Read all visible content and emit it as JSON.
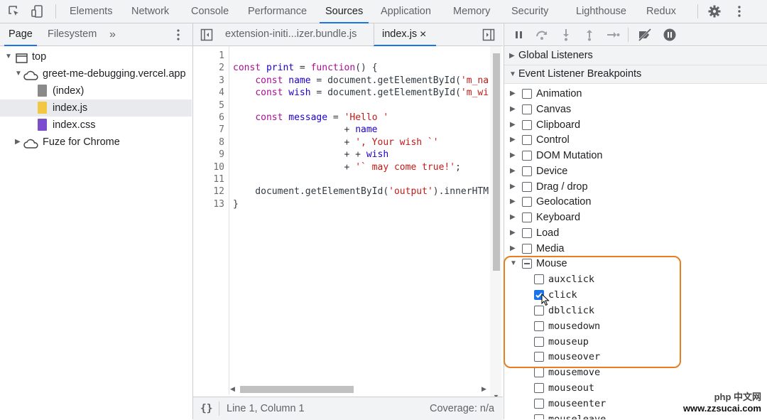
{
  "toolbar": {
    "tabs": [
      "Elements",
      "Network",
      "Console",
      "Performance",
      "Sources",
      "Application",
      "Memory",
      "Security",
      "Lighthouse",
      "Redux"
    ],
    "active_tab": "Sources"
  },
  "navigator": {
    "tabs": [
      "Page",
      "Filesystem"
    ],
    "more": "»",
    "tree": {
      "top": "top",
      "domain": "greet-me-debugging.vercel.app",
      "files": [
        "(index)",
        "index.js",
        "index.css"
      ],
      "selected_file": "index.js",
      "extension": "Fuze for Chrome"
    }
  },
  "editor": {
    "tabs": [
      {
        "label": "extension-initi...izer.bundle.js"
      },
      {
        "label": "index.js",
        "close": "×"
      }
    ],
    "line_numbers": [
      "1",
      "2",
      "3",
      "4",
      "5",
      "6",
      "7",
      "8",
      "9",
      "10",
      "11",
      "12",
      "13"
    ],
    "status": {
      "format_icon": "{}",
      "position": "Line 1, Column 1",
      "coverage": "Coverage: n/a"
    }
  },
  "debugger": {
    "global_listeners": "Global Listeners",
    "event_listener_breakpoints": "Event Listener Breakpoints",
    "categories": [
      "Animation",
      "Canvas",
      "Clipboard",
      "Control",
      "DOM Mutation",
      "Device",
      "Drag / drop",
      "Geolocation",
      "Keyboard",
      "Load",
      "Media"
    ],
    "mouse": {
      "label": "Mouse",
      "events": [
        {
          "name": "auxclick",
          "checked": false
        },
        {
          "name": "click",
          "checked": true
        },
        {
          "name": "dblclick",
          "checked": false
        },
        {
          "name": "mousedown",
          "checked": false
        },
        {
          "name": "mouseup",
          "checked": false
        },
        {
          "name": "mouseover",
          "checked": false
        },
        {
          "name": "mousemove",
          "checked": false
        },
        {
          "name": "mouseout",
          "checked": false
        },
        {
          "name": "mouseenter",
          "checked": false
        },
        {
          "name": "mouseleave",
          "checked": false
        }
      ]
    }
  },
  "watermark": {
    "line1": "php 中文网",
    "line2": "www.zzsucai.com"
  },
  "colors": {
    "accent": "#1a73e8",
    "highlight": "#e67e22"
  }
}
